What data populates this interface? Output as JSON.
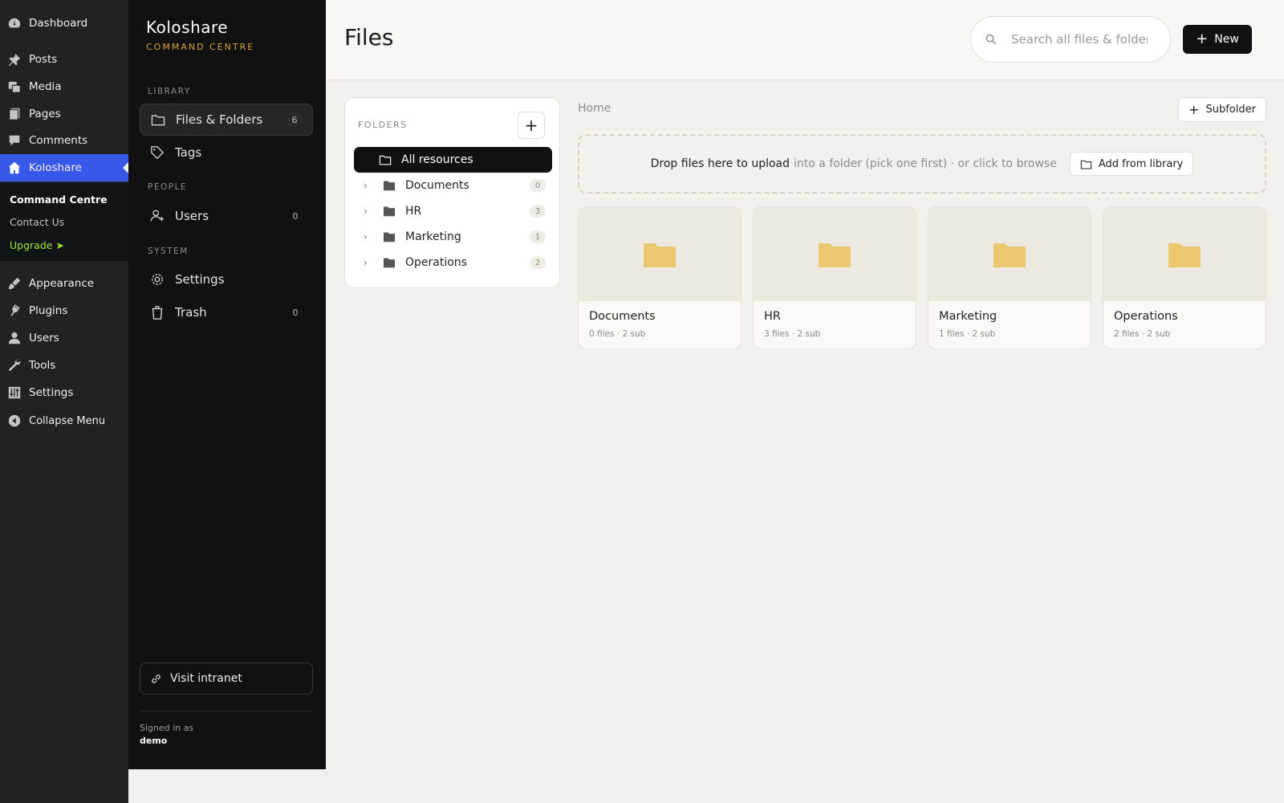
{
  "wp_menu": {
    "items": [
      {
        "label": "Dashboard",
        "icon": "dashboard-icon"
      },
      {
        "label": "Posts",
        "icon": "pin-icon"
      },
      {
        "label": "Media",
        "icon": "media-icon"
      },
      {
        "label": "Pages",
        "icon": "pages-icon"
      },
      {
        "label": "Comments",
        "icon": "comment-icon"
      },
      {
        "label": "Koloshare",
        "icon": "home-icon"
      },
      {
        "label": "Appearance",
        "icon": "brush-icon"
      },
      {
        "label": "Plugins",
        "icon": "plugin-icon"
      },
      {
        "label": "Users",
        "icon": "user-icon"
      },
      {
        "label": "Tools",
        "icon": "wrench-icon"
      },
      {
        "label": "Settings",
        "icon": "sliders-icon"
      },
      {
        "label": "Collapse Menu",
        "icon": "collapse-icon"
      }
    ],
    "submenu": {
      "command_centre": "Command Centre",
      "contact_us": "Contact Us",
      "upgrade": "Upgrade"
    },
    "accent": "#3858e9",
    "upgrade_color": "#a3e635"
  },
  "panel": {
    "brand": "Koloshare",
    "brand_sub": "COMMAND CENTRE",
    "sections": {
      "library": "LIBRARY",
      "people": "PEOPLE",
      "system": "SYSTEM"
    },
    "items": {
      "files": {
        "label": "Files & Folders",
        "count": "6"
      },
      "tags": {
        "label": "Tags"
      },
      "users": {
        "label": "Users",
        "count": "0"
      },
      "settings": {
        "label": "Settings"
      },
      "trash": {
        "label": "Trash",
        "count": "0"
      }
    },
    "visit": "Visit intranet",
    "signed_in_label": "Signed in as",
    "signed_in_user": "demo",
    "brand_accent": "#d9a441"
  },
  "header": {
    "title": "Files",
    "search_placeholder": "Search all files & folders",
    "new_label": "New"
  },
  "folders": {
    "heading": "FOLDERS",
    "add_label": "+",
    "all": "All resources",
    "list": [
      {
        "name": "Documents",
        "count": "0"
      },
      {
        "name": "HR",
        "count": "3"
      },
      {
        "name": "Marketing",
        "count": "1"
      },
      {
        "name": "Operations",
        "count": "2"
      }
    ]
  },
  "content": {
    "breadcrumb": "Home",
    "subfolder_label": "Subfolder",
    "drop_strong": "Drop files here to upload",
    "drop_weak": "into a folder (pick one first) · or click to browse",
    "add_from_library": "Add from library",
    "tiles": [
      {
        "name": "Documents",
        "meta": "0 files  ·  2 sub"
      },
      {
        "name": "HR",
        "meta": "3 files  ·  2 sub"
      },
      {
        "name": "Marketing",
        "meta": "1 files  ·  2 sub"
      },
      {
        "name": "Operations",
        "meta": "2 files  ·  2 sub"
      }
    ],
    "folder_color": "#ebc86f"
  }
}
